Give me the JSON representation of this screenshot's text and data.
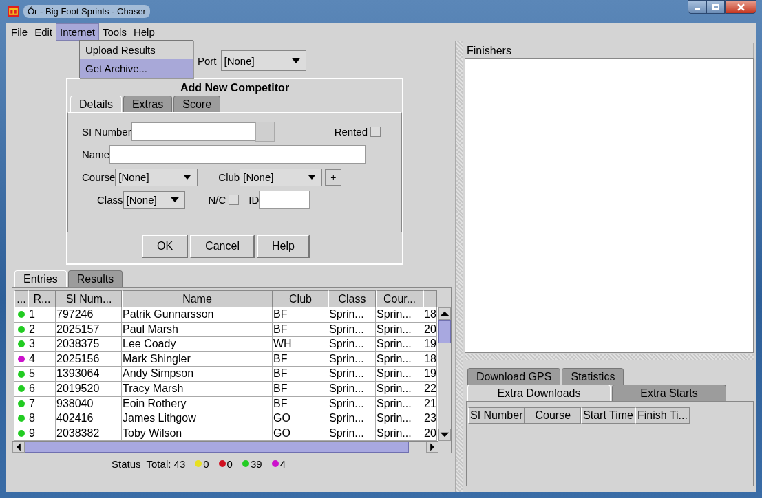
{
  "window": {
    "title": "Ór - Big Foot Sprints - Chaser"
  },
  "menu_bar": [
    {
      "label": "File",
      "selected": false
    },
    {
      "label": "Edit",
      "selected": false
    },
    {
      "label": "Internet",
      "selected": true
    },
    {
      "label": "Tools",
      "selected": false
    },
    {
      "label": "Help",
      "selected": false
    }
  ],
  "menu_dropdown": [
    {
      "label": "Upload Results",
      "selected": false
    },
    {
      "label": "Get Archive...",
      "selected": true
    }
  ],
  "port": {
    "label": "Port",
    "value": "[None]"
  },
  "add_competitor": {
    "title": "Add New Competitor",
    "tabs": [
      {
        "label": "Details",
        "selected": true
      },
      {
        "label": "Extras",
        "selected": false
      },
      {
        "label": "Score",
        "selected": false
      }
    ],
    "si_number_label": "SI Number",
    "rented_label": "Rented",
    "rented_checked": false,
    "name_label": "Name",
    "course_label": "Course",
    "course_value": "[None]",
    "club_label": "Club",
    "club_value": "[None]",
    "add_club": "+",
    "class_label": "Class",
    "class_value": "[None]",
    "nc_label": "N/C",
    "nc_checked": false,
    "id_label": "ID",
    "buttons": [
      "OK",
      "Cancel",
      "Help"
    ]
  },
  "entries_tabs": [
    {
      "label": "Entries",
      "selected": true
    },
    {
      "label": "Results",
      "selected": false
    }
  ],
  "entries_table": {
    "columns": [
      "...",
      "R...",
      "SI Num...",
      "Name",
      "Club",
      "Class",
      "Cour...",
      ""
    ],
    "rows": [
      {
        "color": "#22cc22",
        "r": "1",
        "si": "797246",
        "name": "Patrik Gunnarsson",
        "club": "BF",
        "class": "Sprin...",
        "course": "Sprin...",
        "column_8": "18"
      },
      {
        "color": "#22cc22",
        "r": "2",
        "si": "2025157",
        "name": "Paul Marsh",
        "club": "BF",
        "class": "Sprin...",
        "course": "Sprin...",
        "column_8": "20"
      },
      {
        "color": "#22cc22",
        "r": "3",
        "si": "2038375",
        "name": "Lee Coady",
        "club": "WH",
        "class": "Sprin...",
        "course": "Sprin...",
        "column_8": "19"
      },
      {
        "color": "#cc11cc",
        "r": "4",
        "si": "2025156",
        "name": "Mark Shingler",
        "club": "BF",
        "class": "Sprin...",
        "course": "Sprin...",
        "column_8": "18"
      },
      {
        "color": "#22cc22",
        "r": "5",
        "si": "1393064",
        "name": "Andy Simpson",
        "club": "BF",
        "class": "Sprin...",
        "course": "Sprin...",
        "column_8": "19"
      },
      {
        "color": "#22cc22",
        "r": "6",
        "si": "2019520",
        "name": "Tracy Marsh",
        "club": "BF",
        "class": "Sprin...",
        "course": "Sprin...",
        "column_8": "22"
      },
      {
        "color": "#22cc22",
        "r": "7",
        "si": "938040",
        "name": "Eoin Rothery",
        "club": "BF",
        "class": "Sprin...",
        "course": "Sprin...",
        "column_8": "21"
      },
      {
        "color": "#22cc22",
        "r": "8",
        "si": "402416",
        "name": "James Lithgow",
        "club": "GO",
        "class": "Sprin...",
        "course": "Sprin...",
        "column_8": "23"
      },
      {
        "color": "#22cc22",
        "r": "9",
        "si": "2038382",
        "name": "Toby Wilson",
        "club": "GO",
        "class": "Sprin...",
        "course": "Sprin...",
        "column_8": "20"
      }
    ]
  },
  "status_bar": {
    "label": "Status",
    "total": "Total: 43",
    "counts": [
      {
        "color": "#e8e020",
        "value": "0"
      },
      {
        "color": "#d01020",
        "value": "0"
      },
      {
        "color": "#22cc22",
        "value": "39"
      },
      {
        "color": "#cc11cc",
        "value": "4"
      }
    ]
  },
  "finishers": {
    "label": "Finishers"
  },
  "bottom_tabs": [
    [
      {
        "label": "Download GPS",
        "selected": false
      },
      {
        "label": "Statistics",
        "selected": false
      }
    ],
    [
      {
        "label": "Extra Downloads",
        "selected": true
      },
      {
        "label": "Extra Starts",
        "selected": false
      }
    ]
  ],
  "extra_table": {
    "columns": [
      "SI Number",
      "Course",
      "Start Time",
      "Finish Ti..."
    ]
  }
}
